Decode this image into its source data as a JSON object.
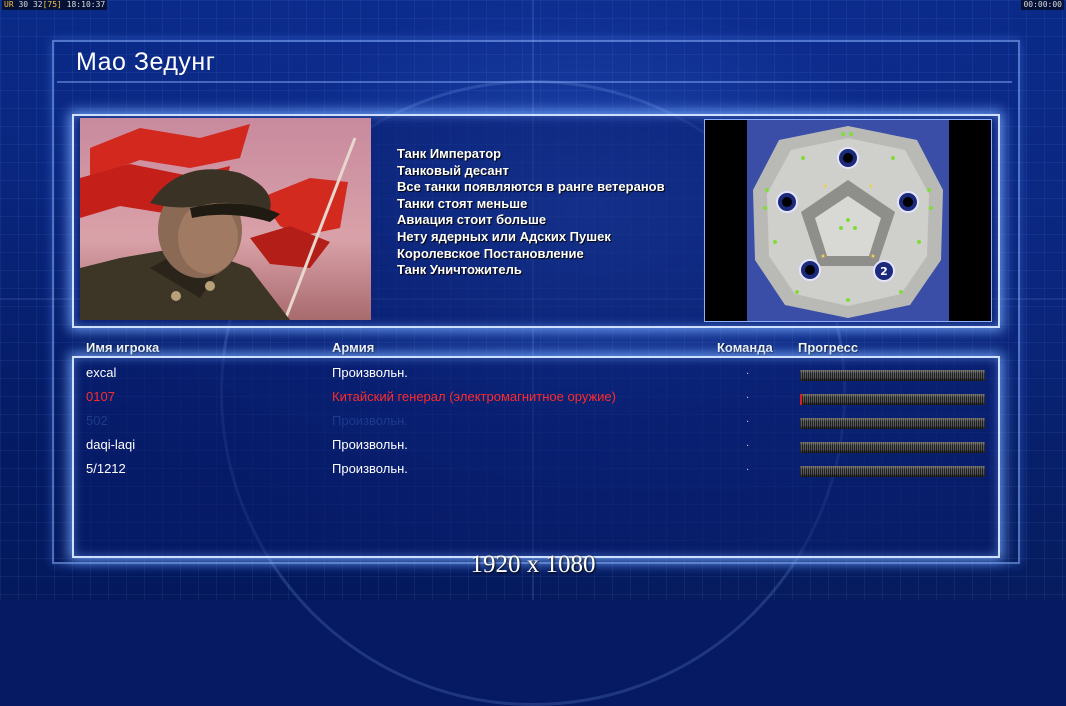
{
  "hud": {
    "left_prefix": "UR",
    "fps_a": "30",
    "fps_b": "32",
    "fps_c": "[75]",
    "clock": "18:10:37",
    "timer": "00:00:00"
  },
  "general": {
    "name": "Мао Зедунг",
    "features": [
      "Танк Император",
      "Танковый десант",
      "Все танки появляются в ранге ветеранов",
      "Танки стоят меньше",
      "Авиация стоит больше",
      "Нету ядерных или Адских Пушек",
      "Королевское Постановление",
      "Танк Уничтожитель"
    ]
  },
  "minimap": {
    "start_marker": "2"
  },
  "table": {
    "headers": {
      "player": "Имя игрока",
      "army": "Армия",
      "team": "Команда",
      "progress": "Прогресс"
    },
    "rows": [
      {
        "name": "excal",
        "army": "Произвольн.",
        "team": ".",
        "progress": 0.0,
        "color": "#ffffff"
      },
      {
        "name": "0107",
        "army": "Китайский генерал (электромагнитное оружие)",
        "team": ".",
        "progress": 0.01,
        "color": "#ff2a2a"
      },
      {
        "name": "502",
        "army": "Произвольн.",
        "team": ".",
        "progress": 0.0,
        "color": "#1d3a8c"
      },
      {
        "name": "daqi-laqi",
        "army": "Произвольн.",
        "team": ".",
        "progress": 0.0,
        "color": "#ffffff"
      },
      {
        "name": "5/1212",
        "army": "Произвольн.",
        "team": ".",
        "progress": 0.0,
        "color": "#ffffff"
      }
    ]
  },
  "resolution": "1920 x 1080"
}
